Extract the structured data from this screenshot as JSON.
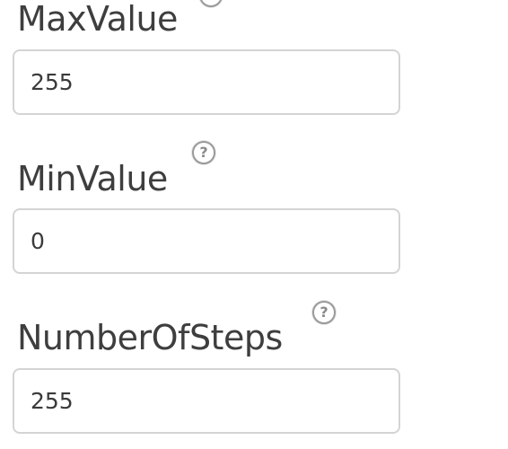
{
  "fields": [
    {
      "label": "MaxValue",
      "value": "255",
      "help_icon": "question-circle-icon",
      "help_glyph": "?"
    },
    {
      "label": "MinValue",
      "value": "0",
      "help_icon": "question-circle-icon",
      "help_glyph": "?"
    },
    {
      "label": "NumberOfSteps",
      "value": "255",
      "help_icon": "question-circle-icon",
      "help_glyph": "?"
    }
  ]
}
